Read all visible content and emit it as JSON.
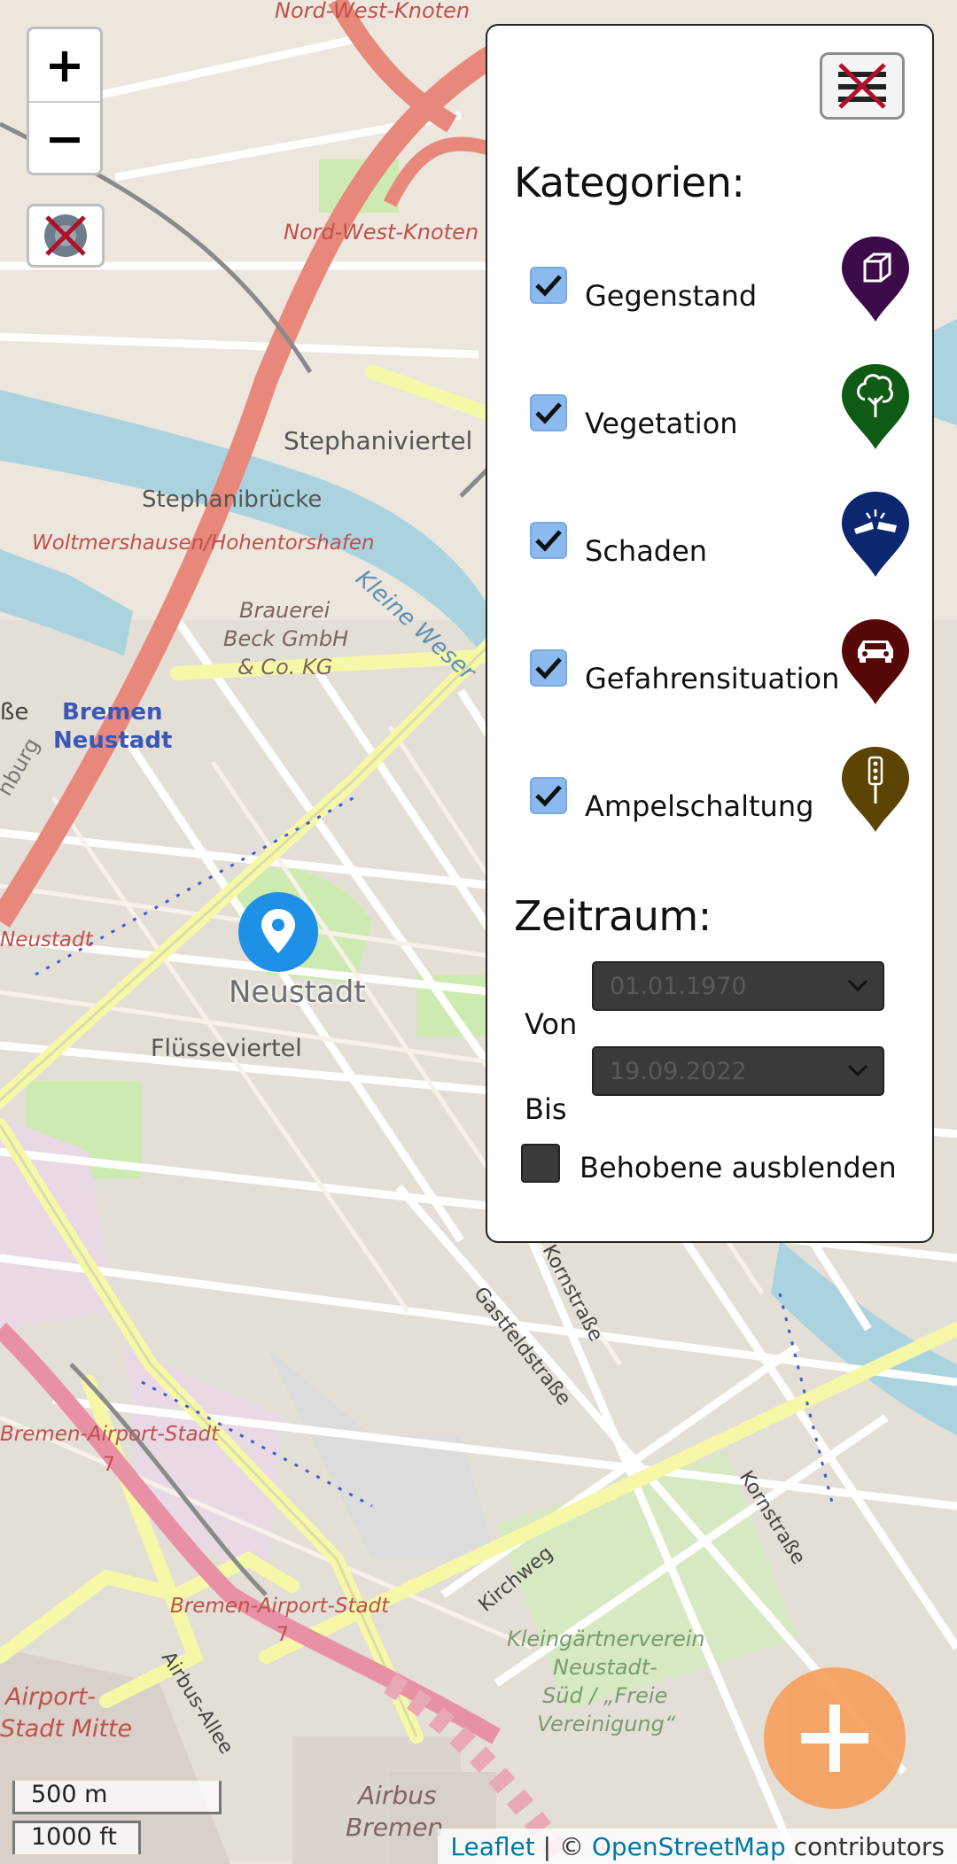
{
  "map": {
    "place_labels": {
      "nord_west_knoten_top": "Nord-West-Knoten",
      "nord_west_knoten": "Nord-West-Knoten",
      "stephaniviertel": "Stephaniviertel",
      "stephanibruecke": "Stephanibrücke",
      "woltmershausen": "Woltmershausen/Hohentorshafen",
      "brauerei_1": "Brauerei",
      "brauerei_2": "Beck GmbH",
      "brauerei_3": "& Co. KG",
      "kleine_weser": "Kleine Weser",
      "bremen_neustadt_1": "Bremen",
      "bremen_neustadt_2": "Neustadt",
      "neustadt_left": "Neustadt",
      "fluesseviertel": "Flüsseviertel",
      "kornstrasse_1": "Kornstraße",
      "gastfeldstrasse": "Gastfeldstraße",
      "kornstrasse_2": "Kornstraße",
      "airport_stadt_1": "Bremen-Airport-Stadt",
      "airport_stadt_2": "Bremen-Airport-Stadt",
      "kirchweg": "Kirchweg",
      "kleingarten_1": "Kleingärtnerverein",
      "kleingarten_2": "Neustadt-",
      "kleingarten_3": "Süd / „Freie",
      "kleingarten_4": "Vereinigung“",
      "airport_mitte_1": "Airport-",
      "airport_mitte_2": "Stadt Mitte",
      "airbus_allee": "Airbus-Allee",
      "airbus_1": "Airbus",
      "airbus_2": "Bremen",
      "route_7a": "7",
      "route_7b": "7",
      "edge_be": "ße",
      "edge_nburg": "nburg"
    },
    "marker_label": "Neustadt"
  },
  "zoom": {
    "in": "+",
    "out": "−"
  },
  "panel": {
    "categories_title": "Kategorien:",
    "categories": [
      {
        "label": "Gegenstand",
        "checked": true,
        "icon": "cube-icon",
        "color": "#3d0b4a"
      },
      {
        "label": "Vegetation",
        "checked": true,
        "icon": "tree-icon",
        "color": "#0f5a14"
      },
      {
        "label": "Schaden",
        "checked": true,
        "icon": "broken-sign-icon",
        "color": "#0c2670"
      },
      {
        "label": "Gefahrensituation",
        "checked": true,
        "icon": "car-icon",
        "color": "#560808"
      },
      {
        "label": "Ampelschaltung",
        "checked": true,
        "icon": "traffic-light-icon",
        "color": "#5c4405"
      }
    ],
    "period_title": "Zeitraum:",
    "from_label": "Von",
    "from_value": "01.01.1970",
    "to_label": "Bis",
    "to_value": "19.09.2022",
    "hide_fixed_label": "Behobene ausblenden",
    "hide_fixed_checked": false
  },
  "scale": {
    "metric": "500 m",
    "imperial": "1000 ft"
  },
  "attribution": {
    "leaflet": "Leaflet",
    "sep": " | © ",
    "osm": "OpenStreetMap",
    "suffix": " contributors"
  },
  "colors": {
    "accent": "#f5a05f",
    "marker": "#1e90e6",
    "checkbox": "#8cb9ee"
  }
}
